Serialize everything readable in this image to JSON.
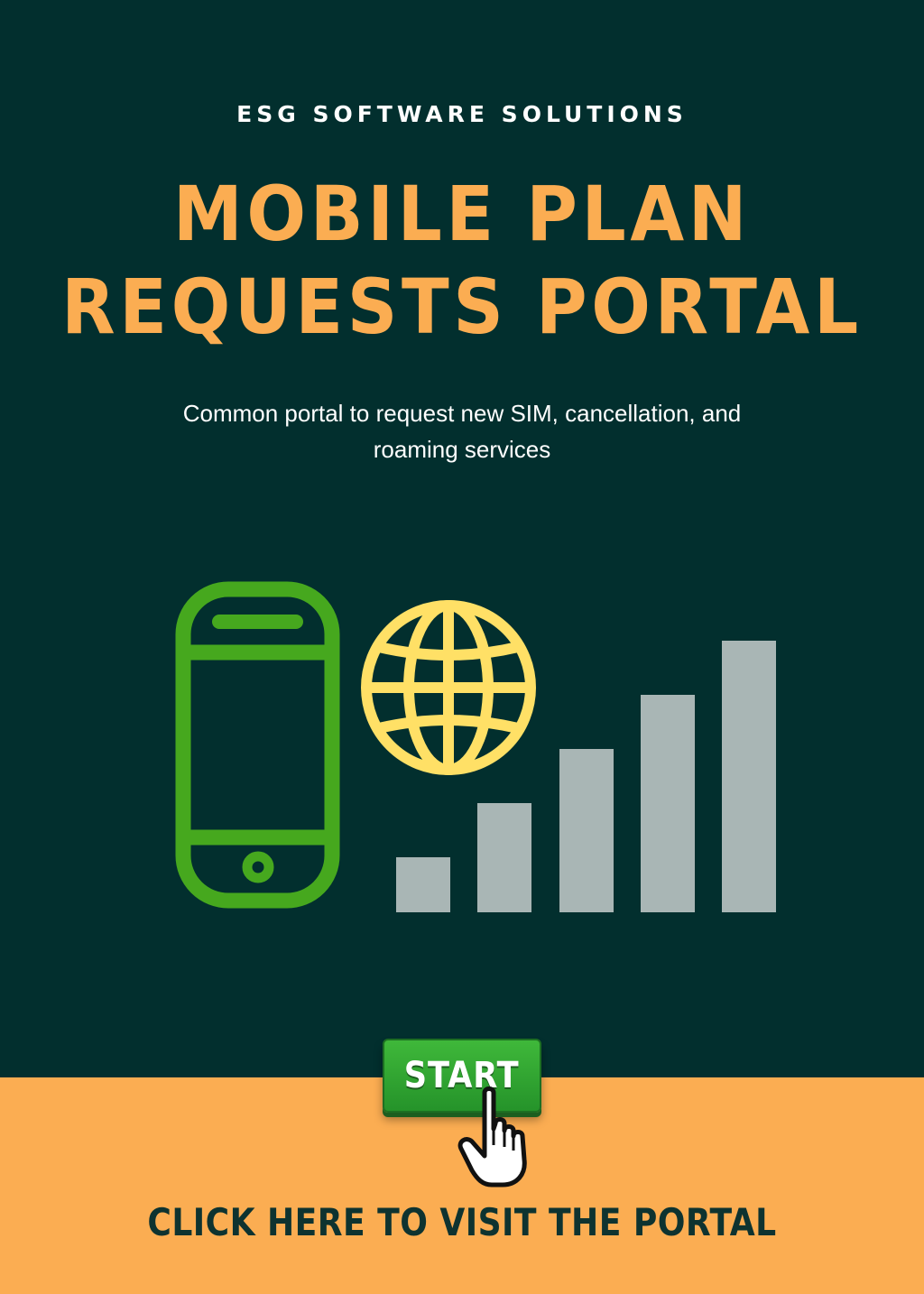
{
  "header": {
    "company": "ESG SOFTWARE SOLUTIONS",
    "title_line1": "MOBILE PLAN",
    "title_line2": "REQUESTS PORTAL",
    "subtitle": "Common portal to request new SIM, cancellation, and roaming services"
  },
  "illustration": {
    "phone_icon": "mobile-phone-icon",
    "globe_icon": "globe-icon",
    "signal_icon": "signal-bars-icon",
    "signal_levels": [
      1,
      2,
      3,
      4,
      5
    ]
  },
  "action": {
    "start_label": "START",
    "cursor_icon": "hand-pointer-icon",
    "cta_label": "CLICK HERE TO VISIT THE PORTAL"
  },
  "colors": {
    "background": "#022f2e",
    "accent": "#fbad52",
    "phone": "#46a81e",
    "globe": "#ffe066",
    "bars": "#a9b6b5",
    "button": "#2fa53a",
    "cta_text": "#0e3330"
  }
}
